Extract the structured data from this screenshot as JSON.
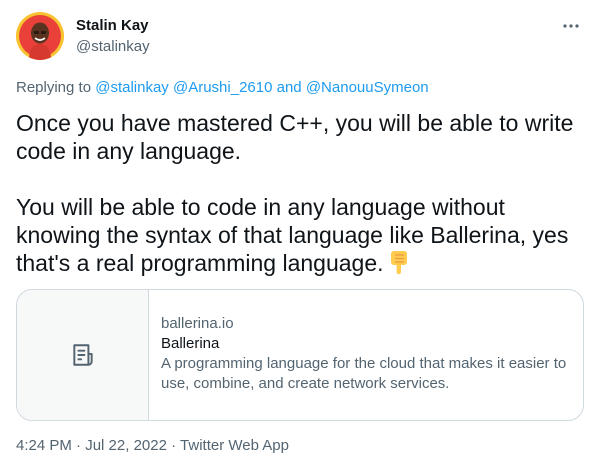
{
  "author": {
    "name": "Stalin Kay",
    "handle": "@stalinkay"
  },
  "reply": {
    "prefix": "Replying to",
    "mention1": "@stalinkay",
    "mention2": "@Arushi_2610",
    "conjunction": "and",
    "mention3": "@NanouuSymeon"
  },
  "tweet": {
    "line1": "Once you have mastered C++, you will be able to write code in any language.",
    "line2": "You will be able to code in any language without knowing the syntax of that language like Ballerina, yes that's a real programming language."
  },
  "card": {
    "domain": "ballerina.io",
    "title": "Ballerina",
    "description": "A programming language for the cloud that makes it easier to use, combine, and create network services."
  },
  "meta": {
    "time": "4:24 PM",
    "separator1": "·",
    "date": "Jul 22, 2022",
    "separator2": "·",
    "source": "Twitter Web App"
  },
  "icons": {
    "more": "more-horizontal-icon",
    "emoji": "backhand-index-pointing-down-emoji",
    "card_placeholder": "document-icon"
  },
  "colors": {
    "link": "#1d9bf0",
    "secondary_text": "#536471",
    "primary_text": "#0f1419",
    "border": "#cfd9de",
    "avatar_ring": "#f8c330"
  }
}
